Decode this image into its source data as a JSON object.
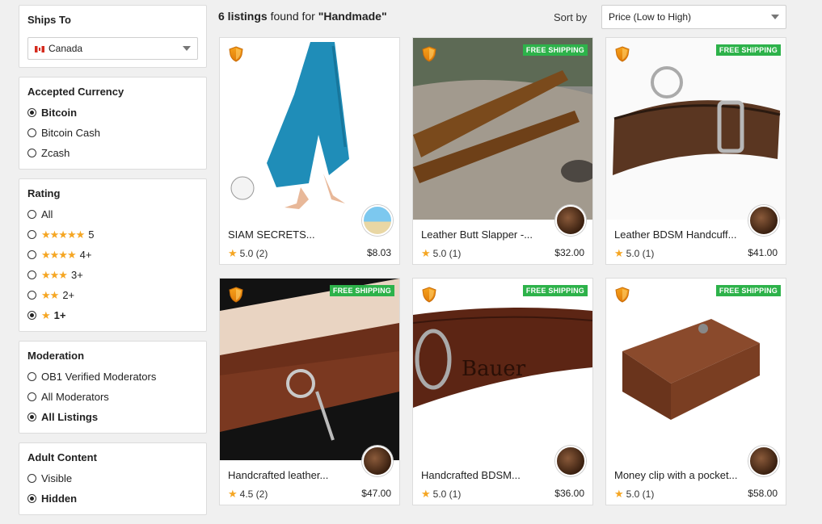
{
  "ships_to": {
    "title": "Ships To",
    "value": "Canada"
  },
  "currency": {
    "title": "Accepted Currency",
    "options": [
      {
        "label": "Bitcoin",
        "selected": true
      },
      {
        "label": "Bitcoin Cash",
        "selected": false
      },
      {
        "label": "Zcash",
        "selected": false
      }
    ]
  },
  "rating": {
    "title": "Rating",
    "options": [
      {
        "label": "All",
        "stars": 0,
        "selected": false
      },
      {
        "label": "5",
        "stars": 5,
        "selected": false
      },
      {
        "label": "4+",
        "stars": 4,
        "selected": false
      },
      {
        "label": "3+",
        "stars": 3,
        "selected": false
      },
      {
        "label": "2+",
        "stars": 2,
        "selected": false
      },
      {
        "label": "1+",
        "stars": 1,
        "selected": true
      }
    ]
  },
  "moderation": {
    "title": "Moderation",
    "options": [
      {
        "label": "OB1 Verified Moderators",
        "selected": false
      },
      {
        "label": "All Moderators",
        "selected": false
      },
      {
        "label": "All Listings",
        "selected": true
      }
    ]
  },
  "adult": {
    "title": "Adult Content",
    "options": [
      {
        "label": "Visible",
        "selected": false
      },
      {
        "label": "Hidden",
        "selected": true
      }
    ]
  },
  "results": {
    "count": "6 listings",
    "found_for": "found for",
    "query": "\"Handmade\""
  },
  "sort": {
    "label": "Sort by",
    "value": "Price (Low to High)"
  },
  "free_shipping_label": "FREE SHIPPING",
  "listings": [
    {
      "title": "SIAM SECRETS...",
      "rating": "5.0 (2)",
      "price": "$8.03",
      "free_shipping": false,
      "image": "pants",
      "avatar": "beach"
    },
    {
      "title": "Leather Butt Slapper -...",
      "rating": "5.0 (1)",
      "price": "$32.00",
      "free_shipping": true,
      "image": "slapper",
      "avatar": "leather"
    },
    {
      "title": "Leather BDSM Handcuff...",
      "rating": "5.0 (1)",
      "price": "$41.00",
      "free_shipping": true,
      "image": "cuff",
      "avatar": "leather"
    },
    {
      "title": "Handcrafted leather...",
      "rating": "4.5 (2)",
      "price": "$47.00",
      "free_shipping": true,
      "image": "wrists",
      "avatar": "leather"
    },
    {
      "title": "Handcrafted BDSM...",
      "rating": "5.0 (1)",
      "price": "$36.00",
      "free_shipping": true,
      "image": "collar",
      "avatar": "leather"
    },
    {
      "title": "Money clip with a pocket...",
      "rating": "5.0 (1)",
      "price": "$58.00",
      "free_shipping": true,
      "image": "wallet",
      "avatar": "leather"
    }
  ]
}
